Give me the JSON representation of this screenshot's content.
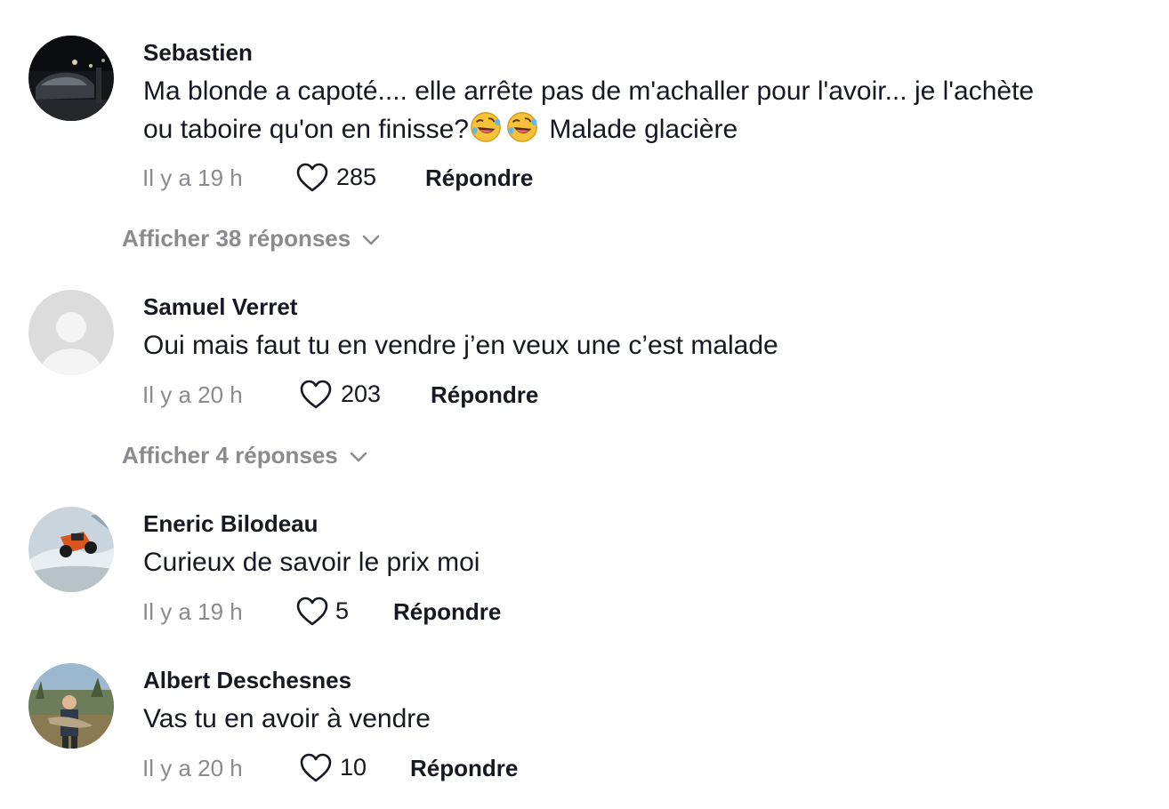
{
  "comments": [
    {
      "username": "Sebastien",
      "text_line1": "Ma blonde a capoté.... elle arrête pas de m'achaller pour l'avoir... je l'achète",
      "text_line2_before": "ou taboire qu'on en finisse?",
      "emoji": "rolling-on-floor-laughing",
      "text_line2_after": " Malade glacière",
      "time": "Il y a 19 h",
      "likes": "285",
      "reply_label": "Répondre",
      "replies_toggle": "Afficher 38 réponses"
    },
    {
      "username": "Samuel Verret",
      "text": "Oui mais faut tu en vendre j’en veux une c’est malade",
      "time": "Il y a 20 h",
      "likes": "203",
      "reply_label": "Répondre",
      "replies_toggle": "Afficher 4 réponses"
    },
    {
      "username": "Eneric Bilodeau",
      "text": "Curieux de savoir le prix moi",
      "time": "Il y a 19 h",
      "likes": "5",
      "reply_label": "Répondre"
    },
    {
      "username": "Albert Deschesnes",
      "text": "Vas tu en avoir à vendre",
      "time": "Il y a 20 h",
      "likes": "10",
      "reply_label": "Répondre"
    }
  ],
  "icons": {
    "like": "heart-outline-icon",
    "expand": "chevron-down-icon",
    "default_avatar": "default-avatar-icon"
  },
  "colors": {
    "text_primary": "#161823",
    "text_secondary": "#8a8b91"
  }
}
